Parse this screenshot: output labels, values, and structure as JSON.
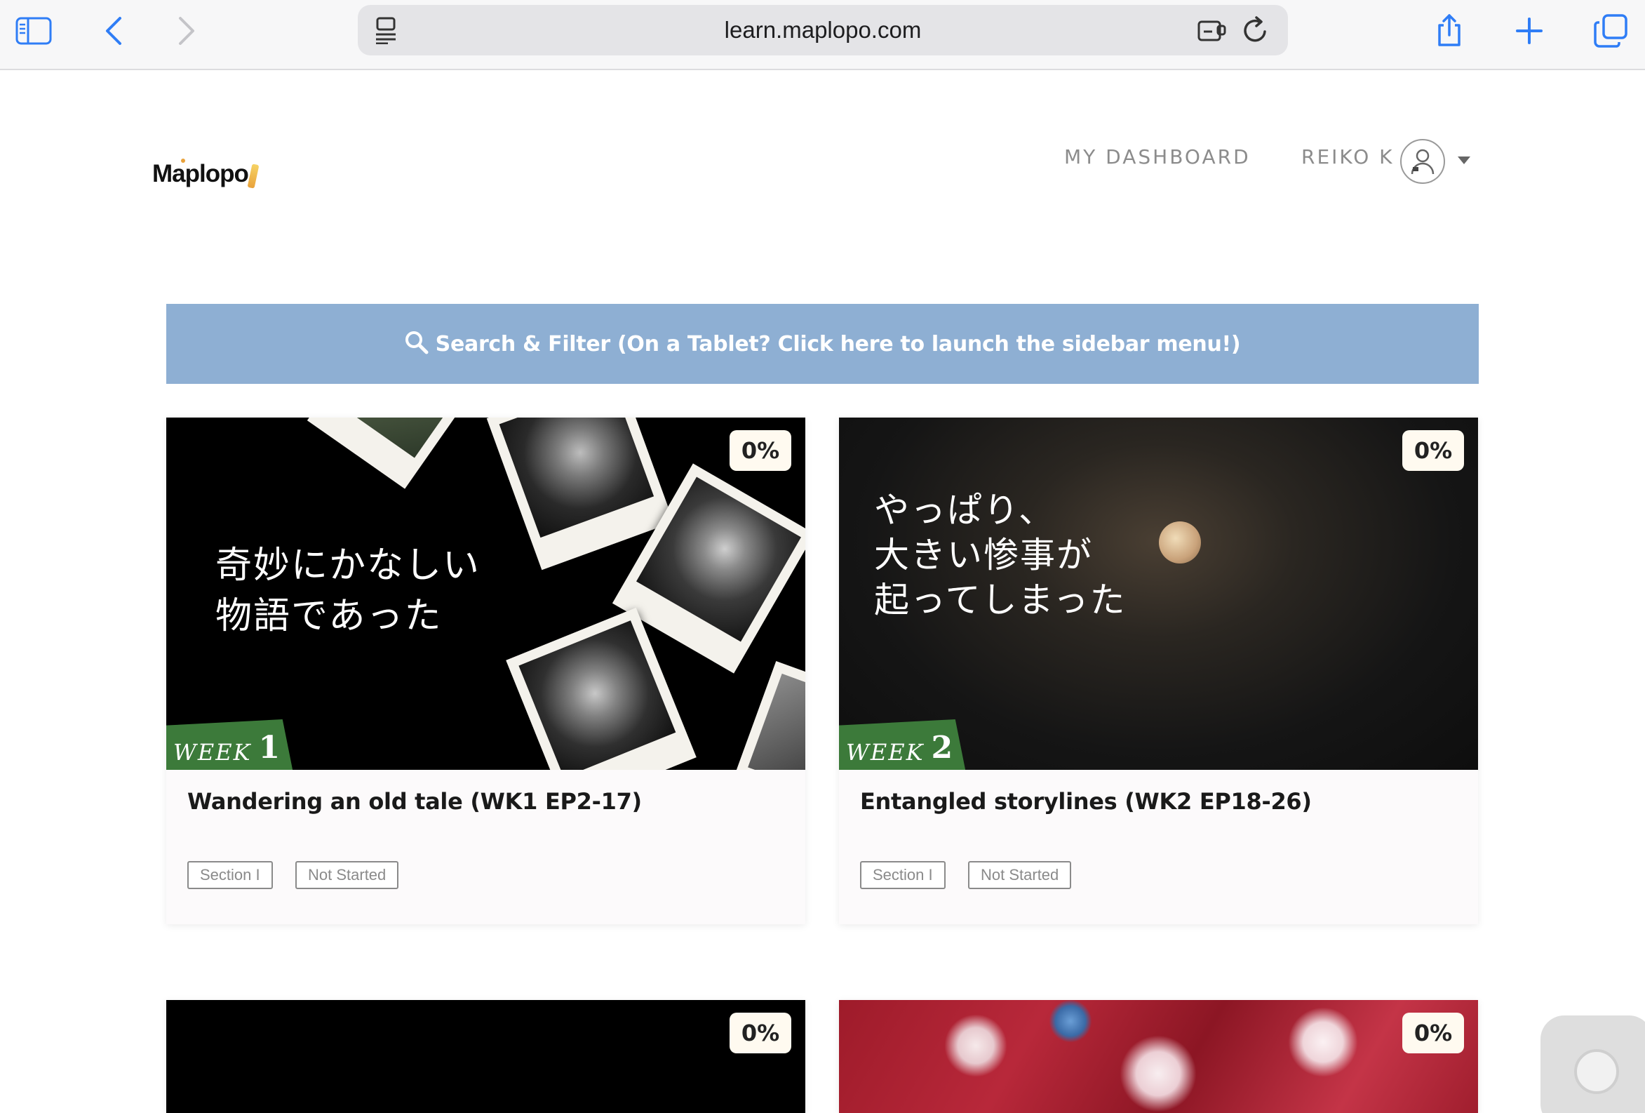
{
  "browser": {
    "url": "learn.maplopo.com",
    "icons": [
      "sidebar-icon",
      "back-icon",
      "forward-icon",
      "reader-icon",
      "extension-icon",
      "reload-icon",
      "share-icon",
      "new-tab-icon",
      "tabs-icon"
    ]
  },
  "site": {
    "logo": "Maplopo",
    "nav": {
      "dashboard": "MY DASHBOARD",
      "user": "REIKO K"
    }
  },
  "search_banner": "Search & Filter (On a Tablet? Click here to launch the sidebar menu!)",
  "cards": [
    {
      "progress": "0%",
      "image_text": [
        "奇妙にかなしい",
        "物語であった"
      ],
      "week_word": "WEEK",
      "week_num": "1",
      "title": "Wandering an old tale (WK1 EP2-17)",
      "tags": [
        "Section I",
        "Not Started"
      ]
    },
    {
      "progress": "0%",
      "image_text": [
        "やっぱり、",
        "大きい惨事が",
        "起ってしまった"
      ],
      "week_word": "WEEK",
      "week_num": "2",
      "title": "Entangled storylines (WK2 EP18-26)",
      "tags": [
        "Section I",
        "Not Started"
      ]
    },
    {
      "progress": "0%"
    },
    {
      "progress": "0%"
    }
  ],
  "colors": {
    "banner": "#8eafd3",
    "week_badge": "#3c7a3a",
    "accent_link": "#8c8c8c"
  }
}
